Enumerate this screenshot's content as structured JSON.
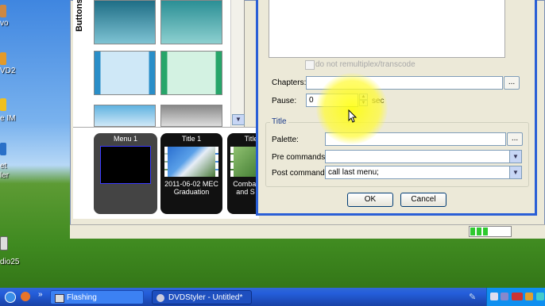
{
  "desktop": {
    "icon_labels": [
      "vo",
      "VD2",
      "e IM",
      "et",
      "ler",
      "dio25"
    ]
  },
  "main_window": {
    "buttons_panel_title": "Buttons",
    "titles": [
      {
        "label": "Menu 1"
      },
      {
        "label": "Title 1",
        "caption_line1": "2011-06-02 MEC",
        "caption_line2": "Graduation"
      },
      {
        "label": "Title",
        "caption_line1": "Combat",
        "caption_line2": "and S"
      }
    ],
    "progress_percent": 50
  },
  "dialog": {
    "remux_checkbox_label": "do not remultiplex/transcode",
    "chapters_label": "Chapters:",
    "chapters_value": "",
    "chapters_browse": "...",
    "pause_label": "Pause:",
    "pause_value": "0",
    "pause_unit": "sec",
    "title_group": "Title",
    "palette_label": "Palette:",
    "palette_value": "",
    "palette_browse": "...",
    "pre_commands_label": "Pre commands:",
    "pre_commands_value": "",
    "post_commands_label": "Post commands:",
    "post_commands_value": "call last menu;",
    "ok_label": "OK",
    "cancel_label": "Cancel"
  },
  "taskbar": {
    "quicklaunch_more": "»",
    "tasks": [
      {
        "label": "Flashing"
      },
      {
        "label": "DVDStyler - Untitled*"
      }
    ]
  },
  "colors": {
    "taskbar": "#245edb",
    "dialog_border": "#2a5fd6",
    "highlight": "#fff64a"
  }
}
